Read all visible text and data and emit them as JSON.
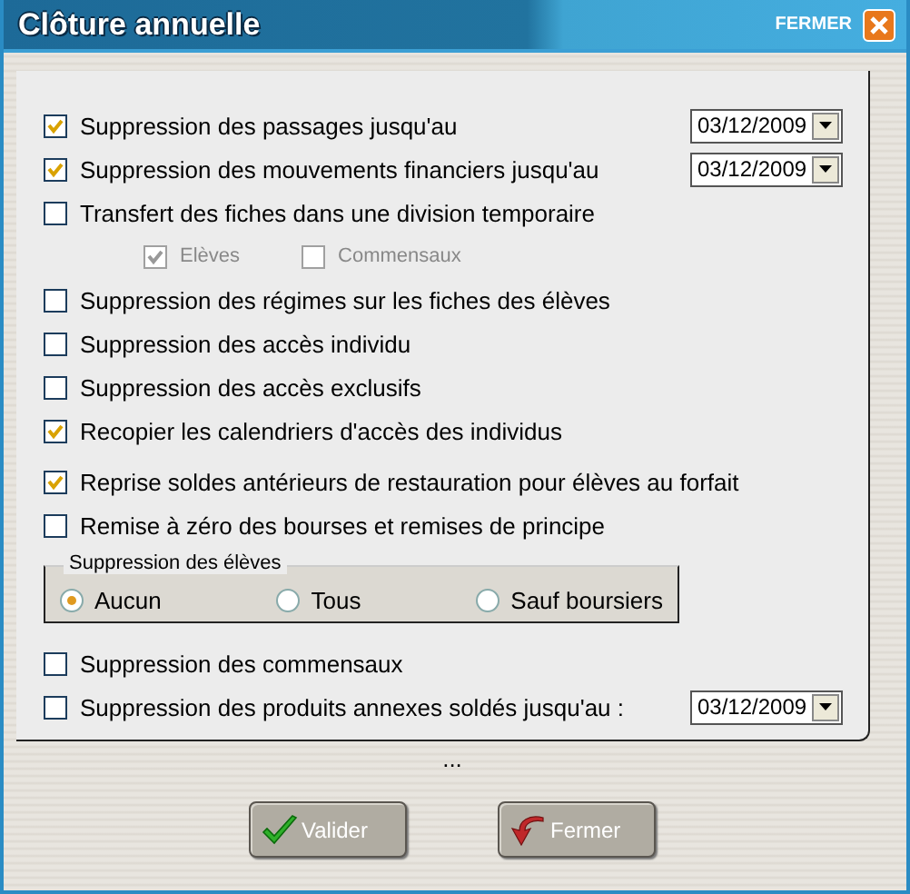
{
  "window": {
    "title": "Clôture annuelle",
    "close_label": "FERMER"
  },
  "options": [
    {
      "kind": "check-date",
      "label": "Suppression des passages jusqu'au",
      "checked": true,
      "date": "03/12/2009"
    },
    {
      "kind": "check-date",
      "label": "Suppression des mouvements financiers jusqu'au",
      "checked": true,
      "date": "03/12/2009"
    },
    {
      "kind": "check",
      "label": "Transfert des fiches dans une division temporaire",
      "checked": false
    },
    {
      "kind": "sub",
      "items": [
        {
          "label": "Elèves",
          "checked": true,
          "disabled": true
        },
        {
          "label": "Commensaux",
          "checked": false,
          "disabled": true
        }
      ]
    },
    {
      "kind": "check",
      "label": "Suppression des régimes sur les fiches des élèves",
      "checked": false
    },
    {
      "kind": "check",
      "label": "Suppression des accès individu",
      "checked": false
    },
    {
      "kind": "check",
      "label": "Suppression des accès exclusifs",
      "checked": false
    },
    {
      "kind": "check",
      "label": "Recopier les calendriers d'accès des individus",
      "checked": true
    },
    {
      "kind": "check",
      "label": "Reprise soldes antérieurs de restauration pour élèves au forfait",
      "checked": true
    },
    {
      "kind": "check",
      "label": "Remise à zéro des bourses et remises de principe",
      "checked": false
    },
    {
      "kind": "radio-group",
      "title": "Suppression des élèves",
      "items": [
        {
          "label": "Aucun",
          "selected": true
        },
        {
          "label": "Tous",
          "selected": false
        },
        {
          "label": "Sauf boursiers",
          "selected": false
        }
      ]
    },
    {
      "kind": "check",
      "label": "Suppression des commensaux",
      "checked": false
    },
    {
      "kind": "check-date",
      "label": "Suppression des produits annexes soldés jusqu'au :",
      "checked": false,
      "date": "03/12/2009"
    }
  ],
  "ellipsis": "...",
  "buttons": [
    {
      "kind": "ok",
      "label": "Valider"
    },
    {
      "kind": "close",
      "label": "Fermer"
    }
  ]
}
